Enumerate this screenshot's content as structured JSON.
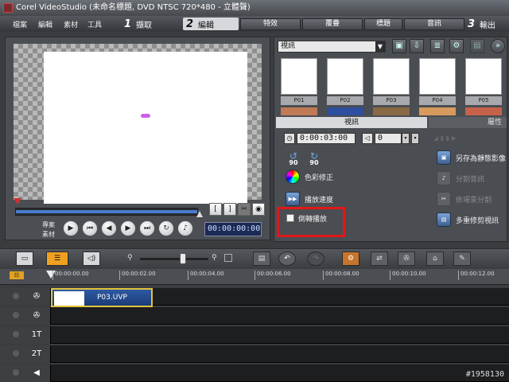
{
  "window": {
    "title": "Corel VideoStudio (未命名標題, DVD NTSC 720*480 - 立體聲)"
  },
  "menu": [
    "檔案",
    "編輯",
    "素材",
    "工具"
  ],
  "steps": [
    {
      "num": "1",
      "label": "擷取"
    },
    {
      "num": "2",
      "label": "編輯"
    },
    {
      "num": "3",
      "label": "輸出"
    }
  ],
  "tabs": [
    "特效",
    "覆疊",
    "標題",
    "音訊"
  ],
  "preview": {
    "mode_label_1": "專案",
    "mode_label_2": "素材",
    "timecode": "00:00:00:00",
    "bracket_in": "[",
    "bracket_out": "]"
  },
  "library": {
    "category": "視訊",
    "thumbs": [
      "P01",
      "P02",
      "P03",
      "P04",
      "P05"
    ]
  },
  "options": {
    "tab_video": "視訊",
    "tab_attr": "屬性",
    "duration": "0:00:03:00",
    "volume": "0",
    "rot_left": "90",
    "rot_right": "90",
    "color_correct": "色彩修正",
    "playback_speed": "播放速度",
    "reverse_play": "倒轉播放",
    "save_still": "另存為靜態影像",
    "split_audio": "分割音訊",
    "split_by_scene": "依場景分割",
    "multi_trim": "多重修剪視訊"
  },
  "timeline": {
    "ticks": [
      "00:00:00.00",
      "00:00:02.00",
      "00:00:04.00",
      "00:00:06.00",
      "00:00:08.00",
      "00:00:10.00",
      "00:00:12.00"
    ],
    "clip_name": "P03.UVP",
    "track_title1": "1T",
    "track_title2": "2T"
  },
  "watermark": "#1958130"
}
